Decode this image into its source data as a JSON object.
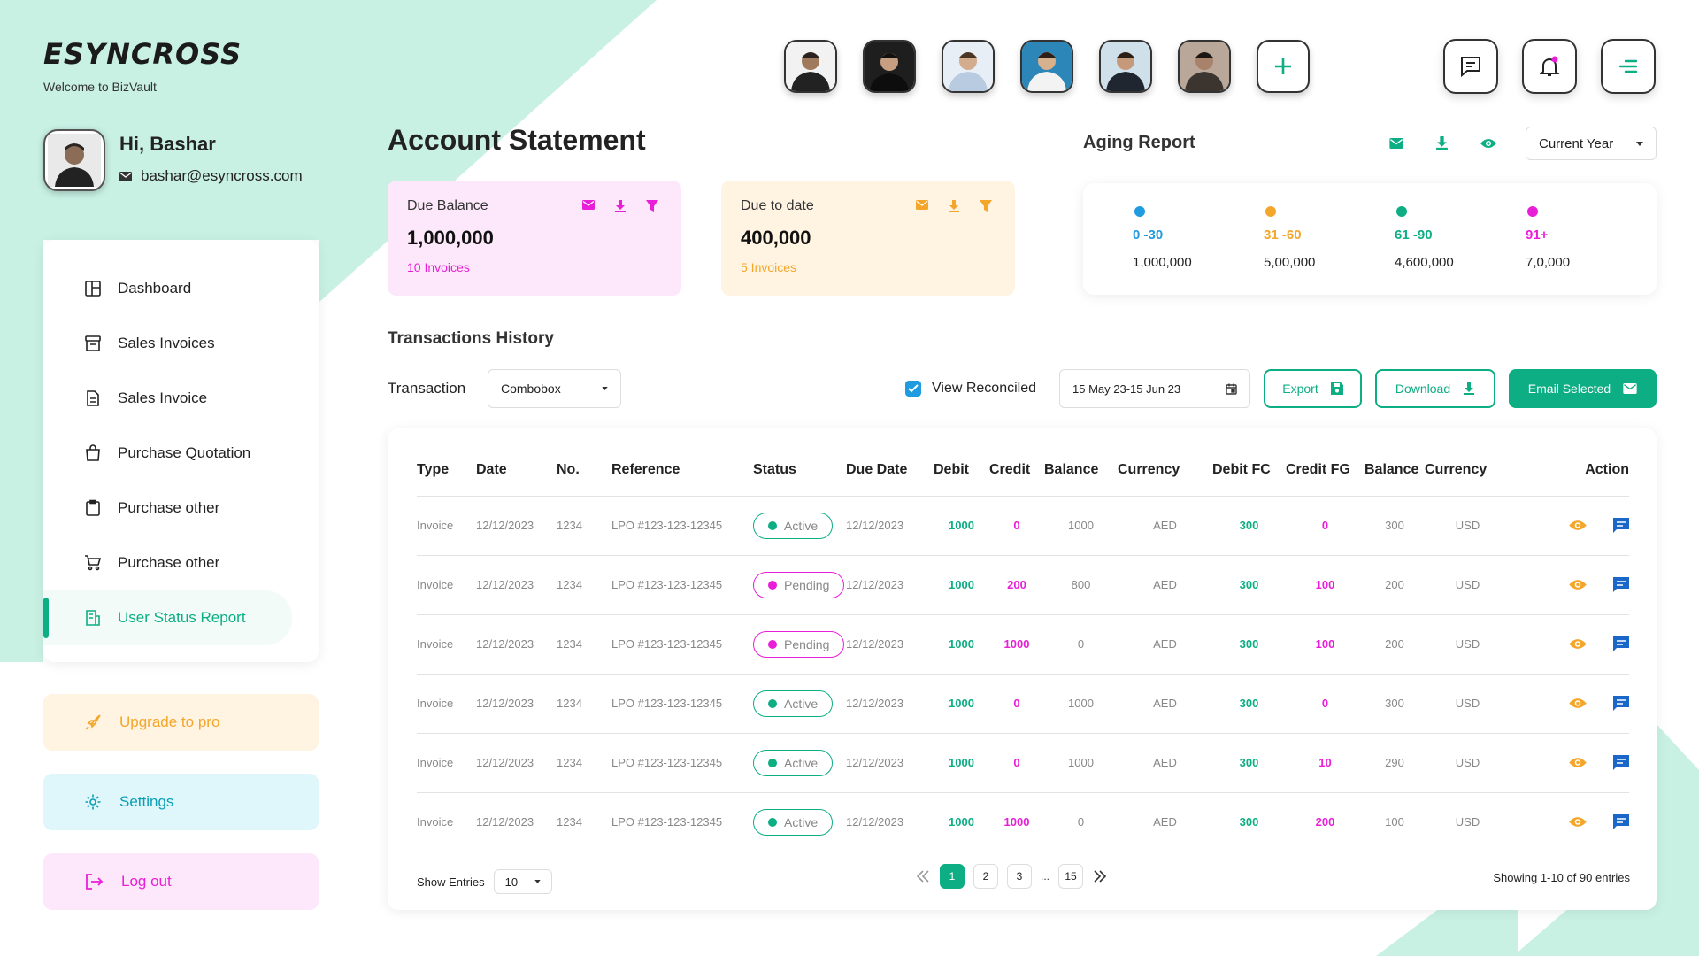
{
  "brand": {
    "logo": "ESYNCROSS",
    "tagline": "Welcome to BizVault"
  },
  "user": {
    "greeting": "Hi, Bashar",
    "email": "bashar@esyncross.com"
  },
  "nav": [
    {
      "label": "Dashboard",
      "icon": "dashboard-icon"
    },
    {
      "label": "Sales Invoices",
      "icon": "archive-icon"
    },
    {
      "label": "Sales Invoice",
      "icon": "document-icon"
    },
    {
      "label": "Purchase Quotation",
      "icon": "shopping-bag-icon"
    },
    {
      "label": "Purchase other",
      "icon": "clipboard-icon"
    },
    {
      "label": "Purchase other",
      "icon": "cart-icon"
    },
    {
      "label": "User Status Report",
      "icon": "report-icon",
      "active": true
    }
  ],
  "side_actions": {
    "upgrade": "Upgrade to pro",
    "settings": "Settings",
    "logout": "Log out"
  },
  "page_title": "Account Statement",
  "due_balance": {
    "label": "Due Balance",
    "value": "1,000,000",
    "count": "10 Invoices"
  },
  "due_to_date": {
    "label": "Due to date",
    "value": "400,000",
    "count": "5 Invoices"
  },
  "aging": {
    "title": "Aging Report",
    "period": "Current Year",
    "buckets": [
      {
        "range": "0 -30",
        "amount": "1,000,000",
        "color": "#1f9be0"
      },
      {
        "range": "31 -60",
        "amount": "5,00,000",
        "color": "#f4a62a"
      },
      {
        "range": "61 -90",
        "amount": "4,600,000",
        "color": "#0dae83"
      },
      {
        "range": "91+",
        "amount": "7,0,000",
        "color": "#e91ed8"
      }
    ]
  },
  "history": {
    "title": "Transactions History",
    "transaction_label": "Transaction",
    "combobox": "Combobox",
    "view_reconciled": "View Reconciled",
    "date_range": "15 May 23-15 Jun 23",
    "export": "Export",
    "download": "Download",
    "email_selected": "Email Selected"
  },
  "table": {
    "headers": [
      "Type",
      "Date",
      "No.",
      "Reference",
      "Status",
      "Due Date",
      "Debit",
      "Credit",
      "Balance",
      "Currency",
      "Debit FC",
      "Credit FG",
      "Balance",
      "Currency",
      "Action"
    ],
    "rows": [
      {
        "type": "Invoice",
        "date": "12/12/2023",
        "no": "1234",
        "ref": "LPO #123-123-12345",
        "status": "Active",
        "due": "12/12/2023",
        "debit": "1000",
        "credit": "0",
        "balance": "1000",
        "cur": "AED",
        "debit_fc": "300",
        "credit_fc": "0",
        "balance_fc": "300",
        "cur2": "USD"
      },
      {
        "type": "Invoice",
        "date": "12/12/2023",
        "no": "1234",
        "ref": "LPO #123-123-12345",
        "status": "Pending",
        "due": "12/12/2023",
        "debit": "1000",
        "credit": "200",
        "balance": "800",
        "cur": "AED",
        "debit_fc": "300",
        "credit_fc": "100",
        "balance_fc": "200",
        "cur2": "USD"
      },
      {
        "type": "Invoice",
        "date": "12/12/2023",
        "no": "1234",
        "ref": "LPO #123-123-12345",
        "status": "Pending",
        "due": "12/12/2023",
        "debit": "1000",
        "credit": "1000",
        "balance": "0",
        "cur": "AED",
        "debit_fc": "300",
        "credit_fc": "100",
        "balance_fc": "200",
        "cur2": "USD"
      },
      {
        "type": "Invoice",
        "date": "12/12/2023",
        "no": "1234",
        "ref": "LPO #123-123-12345",
        "status": "Active",
        "due": "12/12/2023",
        "debit": "1000",
        "credit": "0",
        "balance": "1000",
        "cur": "AED",
        "debit_fc": "300",
        "credit_fc": "0",
        "balance_fc": "300",
        "cur2": "USD"
      },
      {
        "type": "Invoice",
        "date": "12/12/2023",
        "no": "1234",
        "ref": "LPO #123-123-12345",
        "status": "Active",
        "due": "12/12/2023",
        "debit": "1000",
        "credit": "0",
        "balance": "1000",
        "cur": "AED",
        "debit_fc": "300",
        "credit_fc": "10",
        "balance_fc": "290",
        "cur2": "USD"
      },
      {
        "type": "Invoice",
        "date": "12/12/2023",
        "no": "1234",
        "ref": "LPO #123-123-12345",
        "status": "Active",
        "due": "12/12/2023",
        "debit": "1000",
        "credit": "1000",
        "balance": "0",
        "cur": "AED",
        "debit_fc": "300",
        "credit_fc": "200",
        "balance_fc": "100",
        "cur2": "USD"
      }
    ]
  },
  "footer": {
    "show_entries": "Show Entries",
    "entries": "10",
    "pages": [
      "1",
      "2",
      "3",
      "15"
    ],
    "ellipsis": "...",
    "showing": "Showing 1-10 of 90 entries"
  },
  "colors": {
    "accent": "#0dae83",
    "magenta": "#e91ed8",
    "orange": "#f4a62a",
    "mint": "#c8f1e4"
  }
}
